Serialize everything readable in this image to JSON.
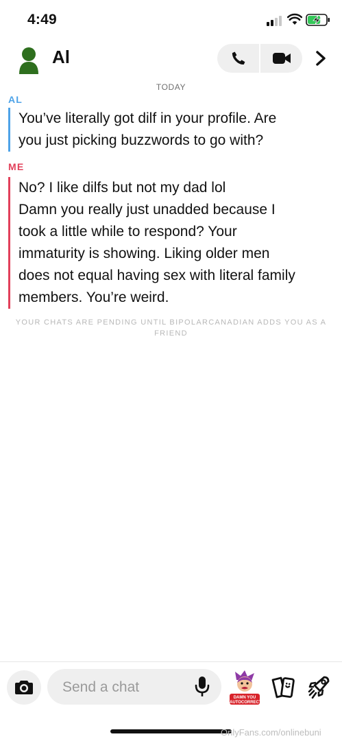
{
  "status_bar": {
    "time": "4:49",
    "signal_bars": 2,
    "battery_level": 0.7,
    "charging": true
  },
  "header": {
    "contact_name": "Al",
    "avatar_color": "#2e6f1e"
  },
  "chat": {
    "date_label": "TODAY",
    "messages": [
      {
        "sender": "AL",
        "sender_color": "#4ea3e8",
        "lines": [
          "You’ve literally got dilf in your profile. Are",
          "you just picking buzzwords to go with?"
        ]
      },
      {
        "sender": "ME",
        "sender_color": "#e2405a",
        "lines": [
          "No? I like dilfs but not my dad lol",
          "Damn you really just unadded because I",
          "took a little while to respond? Your",
          "immaturity is showing. Liking older men",
          "does not equal having sex with literal family",
          "members. You’re weird."
        ]
      }
    ],
    "pending_notice": "YOUR CHATS ARE PENDING UNTIL BIPOLARCANADIAN ADDS YOU AS A FRIEND"
  },
  "composer": {
    "placeholder": "Send a chat",
    "sticker_text": "DAMN YOU AUTOCORRECT!"
  },
  "watermark": "OnlyFans.com/onlinebuni",
  "icons": {
    "camera": "camera-icon",
    "mic": "microphone-icon",
    "sticker": "sticker-icon",
    "cards": "cards-icon",
    "games": "rocket-icon",
    "call": "phone-icon",
    "video": "video-icon",
    "more": "chevron-right-icon"
  }
}
